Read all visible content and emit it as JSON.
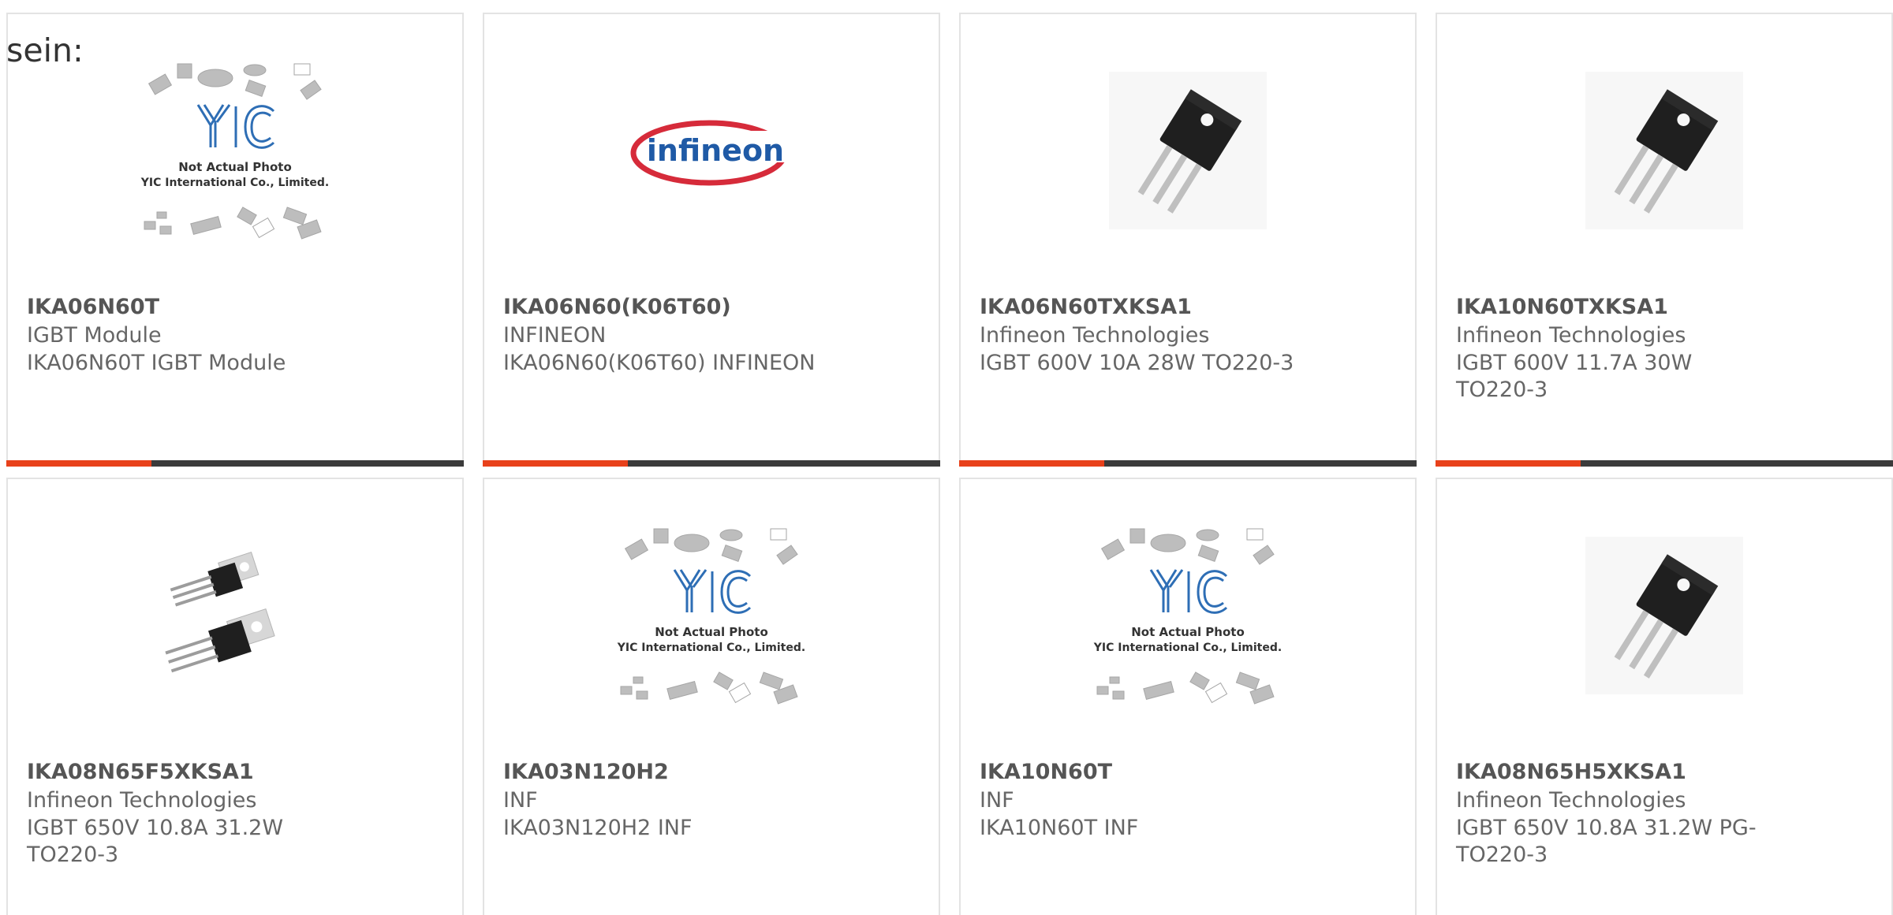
{
  "intro_text": "sein:",
  "accent_color": "#e8411b",
  "bar_color": "#3b3b3b",
  "products": [
    {
      "part_number": "IKA06N60T",
      "manufacturer": "IGBT Module",
      "description": "IKA06N60T IGBT Module",
      "image": "yic-placeholder",
      "placeholder_text": [
        "Not Actual Photo",
        "YIC International Co., Limited."
      ]
    },
    {
      "part_number": "IKA06N60(K06T60)",
      "manufacturer": "INFINEON",
      "description": "IKA06N60(K06T60) INFINEON",
      "image": "infineon-logo",
      "logo_text": "infineon"
    },
    {
      "part_number": "IKA06N60TXKSA1",
      "manufacturer": "Infineon Technologies",
      "description": "IGBT 600V 10A 28W TO220-3",
      "image": "to220-component"
    },
    {
      "part_number": "IKA10N60TXKSA1",
      "manufacturer": "Infineon Technologies",
      "description": "IGBT 600V 11.7A 30W TO220-3",
      "image": "to220-component"
    },
    {
      "part_number": "IKA08N65F5XKSA1",
      "manufacturer": "Infineon Technologies",
      "description": "IGBT 650V 10.8A 31.2W TO220-3",
      "image": "to220-pair"
    },
    {
      "part_number": "IKA03N120H2",
      "manufacturer": "INF",
      "description": "IKA03N120H2 INF",
      "image": "yic-placeholder",
      "placeholder_text": [
        "Not Actual Photo",
        "YIC International Co., Limited."
      ]
    },
    {
      "part_number": "IKA10N60T",
      "manufacturer": "INF",
      "description": "IKA10N60T INF",
      "image": "yic-placeholder",
      "placeholder_text": [
        "Not Actual Photo",
        "YIC International Co., Limited."
      ]
    },
    {
      "part_number": "IKA08N65H5XKSA1",
      "manufacturer": "Infineon Technologies",
      "description": "IGBT 650V 10.8A 31.2W PG-TO220-3",
      "image": "to220-component"
    }
  ]
}
